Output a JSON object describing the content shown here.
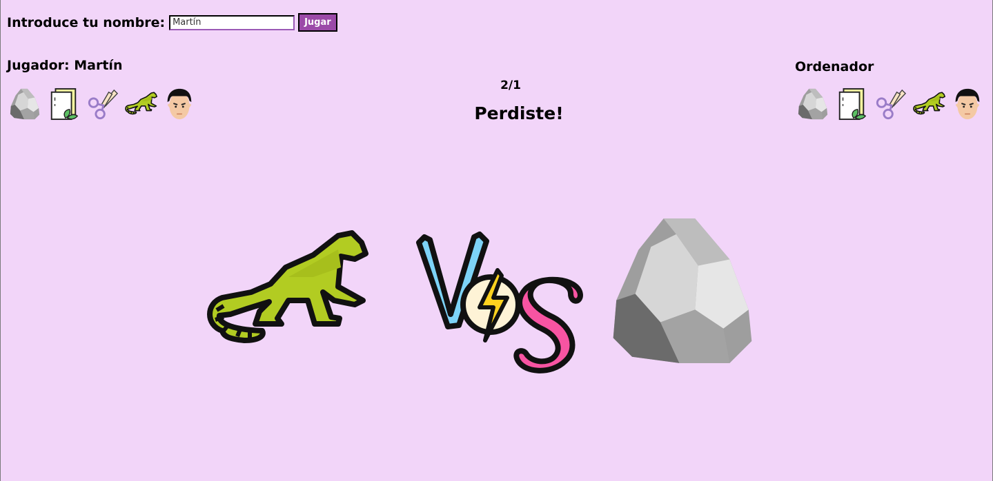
{
  "form": {
    "label": "Introduce tu nombre:",
    "name_value": "Martín",
    "play_label": "Jugar"
  },
  "player": {
    "label": "Jugador: Martín",
    "choices": [
      "rock-icon",
      "paper-icon",
      "scissors-icon",
      "lizard-icon",
      "spock-icon"
    ]
  },
  "computer": {
    "label": "Ordenador",
    "choices": [
      "rock-icon",
      "paper-icon",
      "scissors-icon",
      "lizard-icon",
      "spock-icon"
    ]
  },
  "score": "2/1",
  "result": "Perdiste!",
  "battle": {
    "player_pick": "lizard-icon",
    "vs": "vs-icon",
    "computer_pick": "rock-icon"
  },
  "colors": {
    "background": "#f2d5f9",
    "button": "#9b4aa8",
    "lizard": "#b2cc22",
    "vs_v": "#7dd3f7",
    "vs_s": "#f754a2",
    "bolt": "#ffd21f"
  }
}
